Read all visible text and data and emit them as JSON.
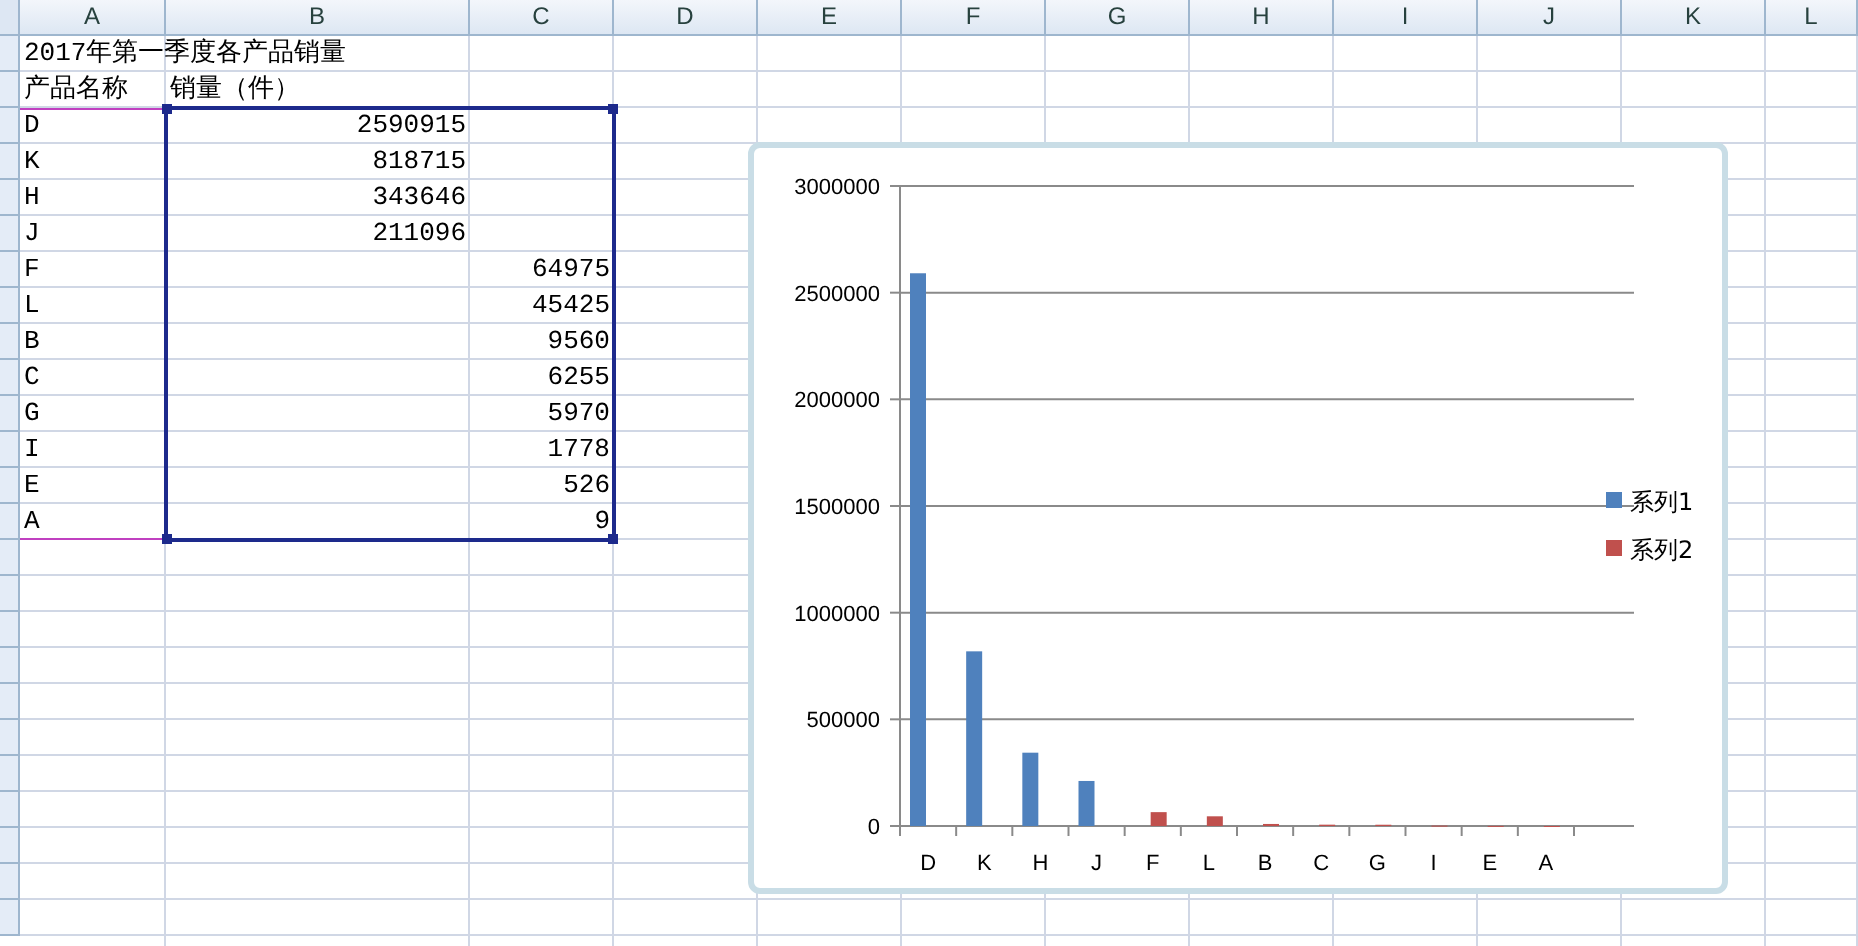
{
  "columns": [
    "A",
    "B",
    "C",
    "D",
    "E",
    "F",
    "G",
    "H",
    "I",
    "J",
    "K",
    "L"
  ],
  "title": "2017年第一季度各产品销量",
  "header": {
    "name": "产品名称",
    "sales": "销量（件）"
  },
  "rows": [
    {
      "name": "D",
      "column_b": "2590915"
    },
    {
      "name": "K",
      "column_b": "818715"
    },
    {
      "name": "H",
      "column_b": "343646"
    },
    {
      "name": "J",
      "column_b": "211096"
    },
    {
      "name": "F",
      "column_c": "64975"
    },
    {
      "name": "L",
      "column_c": "45425"
    },
    {
      "name": "B",
      "column_c": "9560"
    },
    {
      "name": "C",
      "column_c": "6255"
    },
    {
      "name": "G",
      "column_c": "5970"
    },
    {
      "name": "I",
      "column_c": "1778"
    },
    {
      "name": "E",
      "column_c": "526"
    },
    {
      "name": "A",
      "column_c": "9"
    }
  ],
  "chart": {
    "chart_data": {
      "type": "bar",
      "categories": [
        "D",
        "K",
        "H",
        "J",
        "F",
        "L",
        "B",
        "C",
        "G",
        "I",
        "E",
        "A"
      ],
      "series": [
        {
          "name": "系列1",
          "color": "#4f81bd",
          "values": [
            2590915,
            818715,
            343646,
            211096,
            null,
            null,
            null,
            null,
            null,
            null,
            null,
            null
          ]
        },
        {
          "name": "系列2",
          "color": "#c0504d",
          "values": [
            null,
            null,
            null,
            null,
            64975,
            45425,
            9560,
            6255,
            5970,
            1778,
            526,
            9
          ]
        }
      ],
      "legend": true,
      "grid": true,
      "ylim": [
        0,
        3000000
      ],
      "yticks": [
        0,
        500000,
        1000000,
        1500000,
        2000000,
        2500000,
        3000000
      ]
    }
  }
}
